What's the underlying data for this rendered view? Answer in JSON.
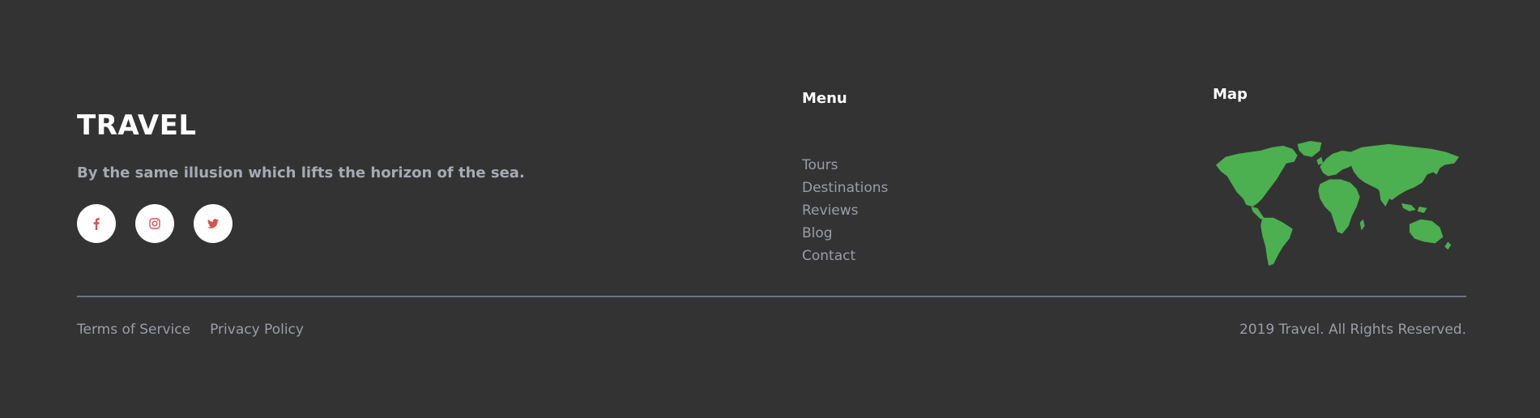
{
  "brand": {
    "title": "TRAVEL",
    "tagline": "By the same illusion which lifts the horizon of the sea."
  },
  "socials": [
    {
      "icon": "facebook-icon",
      "label": "f"
    },
    {
      "icon": "instagram-icon",
      "label": ""
    },
    {
      "icon": "twitter-icon",
      "label": ""
    }
  ],
  "menu": {
    "heading": "Menu",
    "items": [
      "Tours",
      "Destinations",
      "Reviews",
      "Blog",
      "Contact"
    ]
  },
  "map": {
    "heading": "Map",
    "color": "#4caf50"
  },
  "footer": {
    "terms": "Terms of Service",
    "privacy": "Privacy Policy",
    "copyright": "2019 Travel. All Rights Reserved."
  },
  "colors": {
    "background": "#333333",
    "social_icon": "#d9534f",
    "divider": "#6e7488",
    "muted_text": "#9b9da6"
  }
}
